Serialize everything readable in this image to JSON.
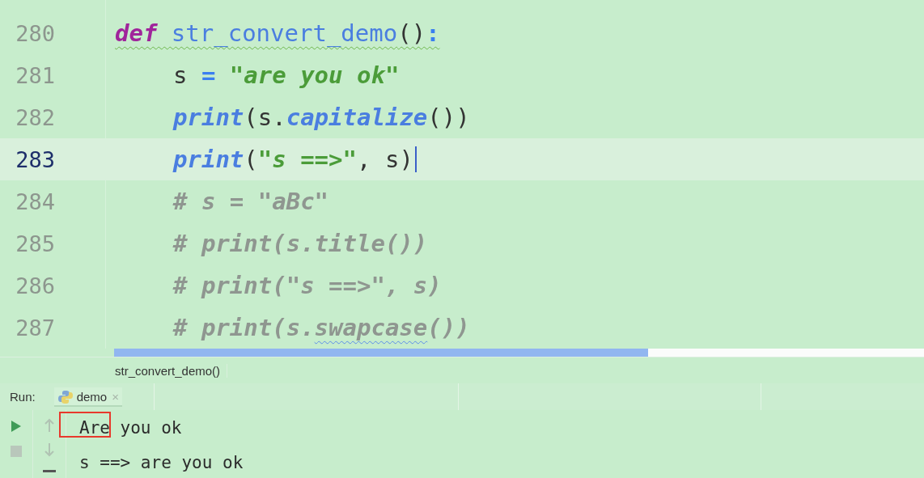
{
  "editor": {
    "lines": [
      {
        "number": "280",
        "current": false,
        "warning": true,
        "tokens": [
          {
            "text": "def ",
            "kind": "keyword"
          },
          {
            "text": "str_convert_demo",
            "kind": "function"
          },
          {
            "text": "()",
            "kind": "punct"
          },
          {
            "text": ":",
            "kind": "operator"
          }
        ],
        "children": [
          {
            "number": "281",
            "current": false,
            "warning": false,
            "tokens": [
              {
                "text": "s ",
                "kind": "plain"
              },
              {
                "text": "=",
                "kind": "operator"
              },
              {
                "text": " \"are you ok\"",
                "kind": "string"
              }
            ]
          },
          {
            "number": "282",
            "current": false,
            "warning": false,
            "tokens": [
              {
                "text": "print",
                "kind": "builtin"
              },
              {
                "text": "(s.",
                "kind": "plain"
              },
              {
                "text": "capitalize",
                "kind": "method"
              },
              {
                "text": "())",
                "kind": "punct"
              }
            ]
          },
          {
            "number": "283",
            "current": true,
            "warning": false,
            "tokens": [
              {
                "text": "print",
                "kind": "builtin"
              },
              {
                "text": "(",
                "kind": "punct"
              },
              {
                "text": "\"s ==>\"",
                "kind": "string"
              },
              {
                "text": ", s)",
                "kind": "plain"
              }
            ]
          },
          {
            "number": "284",
            "current": false,
            "warning": false,
            "tokens": [
              {
                "text": "# s = \"aBc\"",
                "kind": "comment"
              }
            ]
          },
          {
            "number": "285",
            "current": false,
            "warning": false,
            "tokens": [
              {
                "text": "# print(s.title())",
                "kind": "comment"
              }
            ]
          },
          {
            "number": "286",
            "current": false,
            "warning": false,
            "tokens": [
              {
                "text": "# print(\"s ==>\", s)",
                "kind": "comment"
              }
            ]
          },
          {
            "number": "287",
            "current": false,
            "warning": false,
            "tokens": [
              {
                "text": "# print(s.",
                "kind": "comment"
              },
              {
                "text": "swapcase",
                "kind": "comment",
                "typo": true
              },
              {
                "text": "())",
                "kind": "comment"
              }
            ]
          }
        ]
      }
    ]
  },
  "breadcrumb": "str_convert_demo()",
  "run_panel": {
    "label": "Run:",
    "tabs": [
      {
        "label": "demo",
        "close": "×",
        "selected": true
      }
    ],
    "console": [
      "Are you ok",
      "s ==> are you ok"
    ]
  }
}
